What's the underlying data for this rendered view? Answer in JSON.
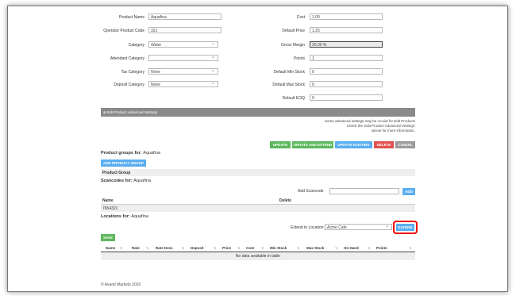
{
  "form": {
    "product_name_label": "Product Name",
    "product_name_value": "Aquafina",
    "operator_code_label": "Operator Product Code",
    "operator_code_value": "321",
    "category_label": "Category",
    "category_value": "Water",
    "attendant_category_label": "Attendant Category",
    "attendant_category_value": "",
    "tax_category_label": "Tax Category",
    "tax_category_value": "None",
    "deposit_category_label": "Deposit Category",
    "deposit_category_value": "None",
    "cost_label": "Cost",
    "cost_value": "1.00",
    "default_price_label": "Default Price",
    "default_price_value": "1.25",
    "gross_margin_label": "Gross Margin",
    "gross_margin_value": "20.00 %",
    "points_label": "Points",
    "points_value": "1",
    "default_min_stock_label": "Default Min Stock",
    "default_min_stock_value": "0",
    "default_max_stock_label": "Default Max Stock",
    "default_max_stock_value": "0",
    "default_eoq_label": "Default EOQ",
    "default_eoq_value": "0"
  },
  "advanced": {
    "bar_label": "Edit Product Advanced Settings",
    "note_line1": "Some advanced settings may be crucial for Edit Products",
    "note_line2": "Check the 'Edit Product Advanced Settings'",
    "note_line3": "above for more information."
  },
  "actions": {
    "update": "UPDATE",
    "update_extend": "UPDATE AND EXTEND",
    "update_existing": "UPDATE EXISTING",
    "delete": "DELETE",
    "cancel": "CANCEL"
  },
  "product_groups": {
    "title": "Product groups for:",
    "product": "Aquafina",
    "add_button": "ADD PRODUCT GROUP",
    "column": "Product Group"
  },
  "scancodes": {
    "title": "Scancodes for:",
    "product": "Aquafina",
    "add_label": "Add Scancode",
    "add_button": "ADD",
    "col_name": "Name",
    "col_delete": "Delete",
    "rows": [
      "7654321"
    ]
  },
  "locations": {
    "title": "Locations for:",
    "product": "Aquafina",
    "extend_label": "Extend to Location:",
    "extend_value": "Acme Cafe",
    "extend_button": "EXTEND",
    "save_button": "SAVE",
    "columns": [
      "Name",
      "Rate",
      "Rate Desc",
      "Deposit",
      "Price",
      "Cost",
      "Min Stock",
      "Max Stock",
      "On Hand",
      "Points"
    ],
    "empty": "No data available in table"
  },
  "footer": "© Avanti Markets 2020"
}
